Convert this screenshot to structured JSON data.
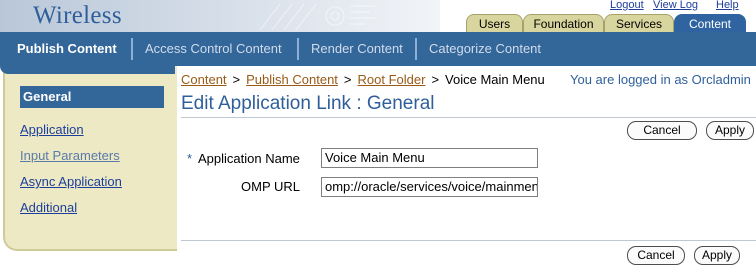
{
  "app": {
    "brand": "Wireless"
  },
  "global_links": [
    "Logout",
    "View Log",
    "Help"
  ],
  "tabs": [
    {
      "label": "Users",
      "active": false
    },
    {
      "label": "Foundation",
      "active": false
    },
    {
      "label": "Services",
      "active": false
    },
    {
      "label": "Content",
      "active": true
    }
  ],
  "subtabs": [
    {
      "label": "Publish Content",
      "active": true
    },
    {
      "label": "Access Control Content",
      "active": false
    },
    {
      "label": "Render Content",
      "active": false
    },
    {
      "label": "Categorize Content",
      "active": false
    }
  ],
  "sidebar": {
    "items": [
      {
        "label": "General",
        "selected": true
      },
      {
        "label": "Application",
        "selected": false
      },
      {
        "label": "Input Parameters",
        "selected": false
      },
      {
        "label": "Async Application",
        "selected": false
      },
      {
        "label": "Additional",
        "selected": false
      }
    ]
  },
  "breadcrumb": {
    "links": [
      "Content",
      "Publish Content",
      "Root Folder"
    ],
    "current": "Voice Main Menu",
    "separator": ">"
  },
  "login_status": "You are logged in as Orcladmin",
  "page": {
    "title": "Edit Application Link : General"
  },
  "buttons": {
    "cancel": "Cancel",
    "apply": "Apply"
  },
  "form": {
    "required_marker": "*",
    "application_name": {
      "label": "Application Name",
      "value": "Voice Main Menu"
    },
    "omp_url": {
      "label": "OMP URL",
      "value": "omp://oracle/services/voice/mainmenu"
    }
  },
  "colors": {
    "accent": "#336699",
    "tab_inactive": "#d9d59e",
    "sidebar_bg": "#ece9c4",
    "link": "#1d3f9a",
    "crumb_link": "#9a5a17"
  }
}
